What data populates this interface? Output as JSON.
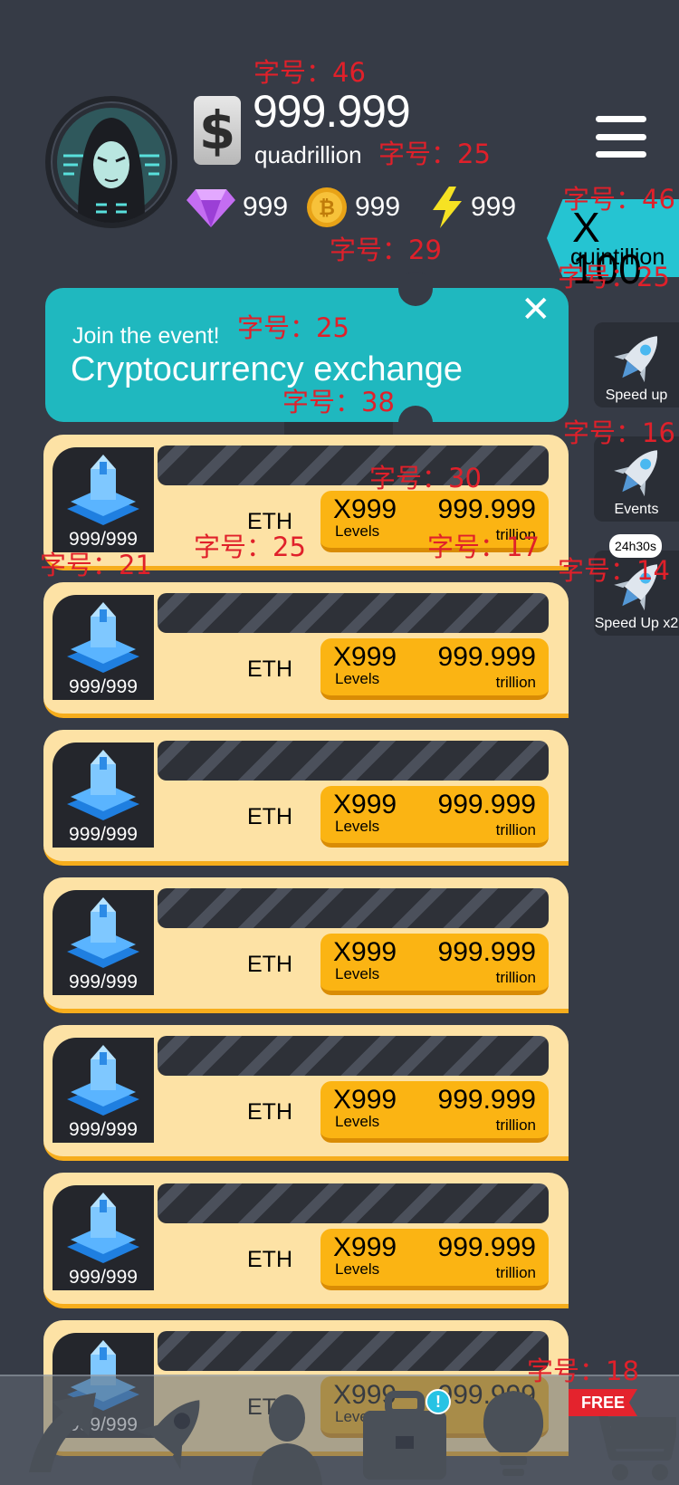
{
  "player": {
    "money_value": "999.999",
    "money_unit": "quadrillion",
    "currency_symbol": "$"
  },
  "resources": [
    {
      "name": "diamond-icon",
      "value": "999"
    },
    {
      "name": "bitcoin-icon",
      "value": "999"
    },
    {
      "name": "energy-icon",
      "value": "999"
    }
  ],
  "multiplier": {
    "value": "X 100",
    "unit": "quintillion"
  },
  "event": {
    "subtitle": "Join the event!",
    "title": "Cryptocurrency exchange",
    "close": "✕"
  },
  "side_buttons": [
    {
      "label": "Speed up",
      "icon": "rocket-icon"
    },
    {
      "label": "Events",
      "icon": "rocket-icon"
    },
    {
      "label": "Speed Up x2",
      "icon": "rocket-icon",
      "timer": "24h30s"
    }
  ],
  "cards": [
    {
      "name": "ETH",
      "count": "999/999",
      "multiplier": "X999",
      "levels": "Levels",
      "cost": "999.999",
      "cost_unit": "trillion"
    },
    {
      "name": "ETH",
      "count": "999/999",
      "multiplier": "X999",
      "levels": "Levels",
      "cost": "999.999",
      "cost_unit": "trillion"
    },
    {
      "name": "ETH",
      "count": "999/999",
      "multiplier": "X999",
      "levels": "Levels",
      "cost": "999.999",
      "cost_unit": "trillion"
    },
    {
      "name": "ETH",
      "count": "999/999",
      "multiplier": "X999",
      "levels": "Levels",
      "cost": "999.999",
      "cost_unit": "trillion"
    },
    {
      "name": "ETH",
      "count": "999/999",
      "multiplier": "X999",
      "levels": "Levels",
      "cost": "999.999",
      "cost_unit": "trillion"
    },
    {
      "name": "ETH",
      "count": "999/999",
      "multiplier": "X999",
      "levels": "Levels",
      "cost": "999.999",
      "cost_unit": "trillion"
    },
    {
      "name": "ETH",
      "count": "999/999",
      "multiplier": "X999",
      "levels": "Levels",
      "cost": "999.999",
      "cost_unit": "trillion"
    }
  ],
  "bottom_nav": {
    "items": [
      "upgrade-arrow-icon",
      "rocket-icon",
      "manager-icon",
      "briefcase-icon",
      "idea-bulb-icon",
      "shop-cart-icon"
    ],
    "alert_badge": "!",
    "free_label": "FREE"
  },
  "annotations": [
    "字号：46",
    "字号：25",
    "字号：29",
    "字号：46",
    "字号：25",
    "字号：25",
    "字号：38",
    "字号：16",
    "字号：30",
    "字号：25",
    "字号：17",
    "字号：21",
    "字号：14",
    "字号：18"
  ],
  "colors": {
    "background": "#363b46",
    "teal": "#1fb8bf",
    "card": "#fde2a5",
    "button": "#fbb413",
    "annotation": "#e0202a"
  }
}
